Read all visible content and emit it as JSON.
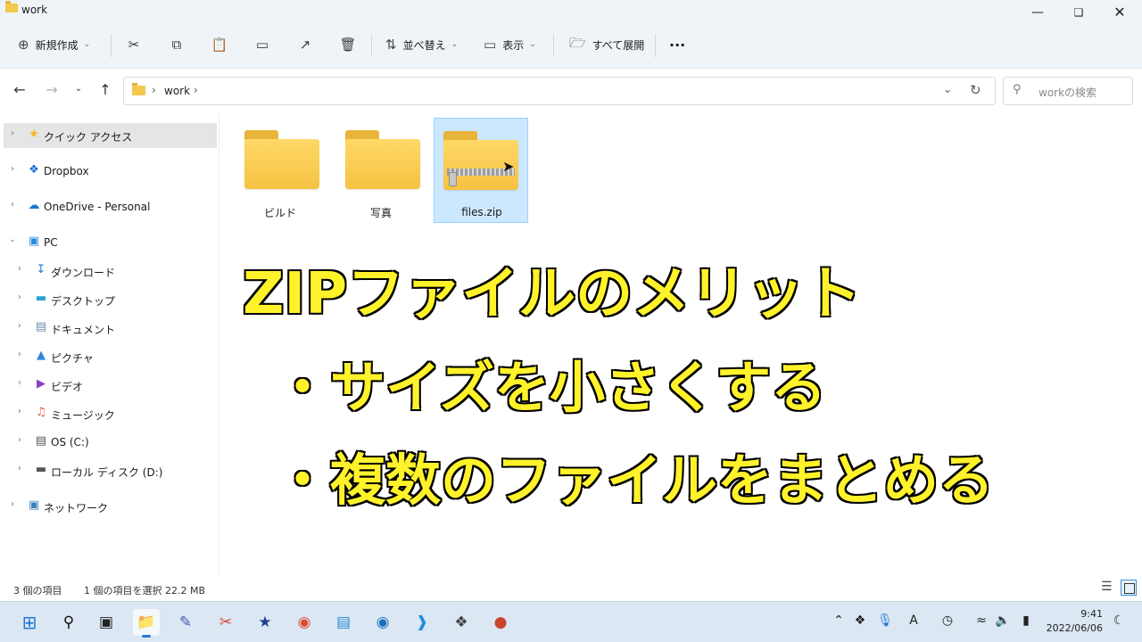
{
  "window": {
    "title": "work"
  },
  "toolbar": {
    "new_label": "新規作成",
    "sort_label": "並べ替え",
    "view_label": "表示",
    "extract_label": "すべて展開",
    "more_label": "···"
  },
  "address": {
    "crumb": "work",
    "search_placeholder": "workの検索"
  },
  "sidebar": {
    "items": [
      {
        "label": "クイック アクセス",
        "icon": "star-icon"
      },
      {
        "label": "Dropbox",
        "icon": "dropbox-icon"
      },
      {
        "label": "OneDrive - Personal",
        "icon": "cloud-icon"
      },
      {
        "label": "PC",
        "icon": "monitor-icon"
      },
      {
        "label": "ダウンロード",
        "icon": "download-icon"
      },
      {
        "label": "デスクトップ",
        "icon": "desktop-icon"
      },
      {
        "label": "ドキュメント",
        "icon": "document-icon"
      },
      {
        "label": "ピクチャ",
        "icon": "picture-icon"
      },
      {
        "label": "ビデオ",
        "icon": "video-icon"
      },
      {
        "label": "ミュージック",
        "icon": "music-icon"
      },
      {
        "label": "OS (C:)",
        "icon": "drive-icon"
      },
      {
        "label": "ローカル ディスク (D:)",
        "icon": "drive-icon"
      },
      {
        "label": "ネットワーク",
        "icon": "network-icon"
      }
    ]
  },
  "files": [
    {
      "name": "ビルド",
      "type": "folder"
    },
    {
      "name": "写真",
      "type": "folder"
    },
    {
      "name": "files.zip",
      "type": "zip"
    }
  ],
  "overlay": {
    "title": "ZIPファイルのメリット",
    "bullet1": "・サイズを小さくする",
    "bullet2": "・複数のファイルをまとめる"
  },
  "status": {
    "count": "3 個の項目",
    "selection": "1 個の項目を選択  22.2 MB"
  },
  "clock": {
    "time": "9:41",
    "date": "2022/06/06"
  },
  "colors": {
    "overlay_text": "#fff22a",
    "selection": "#cce8ff",
    "folder": "#f5c242"
  }
}
